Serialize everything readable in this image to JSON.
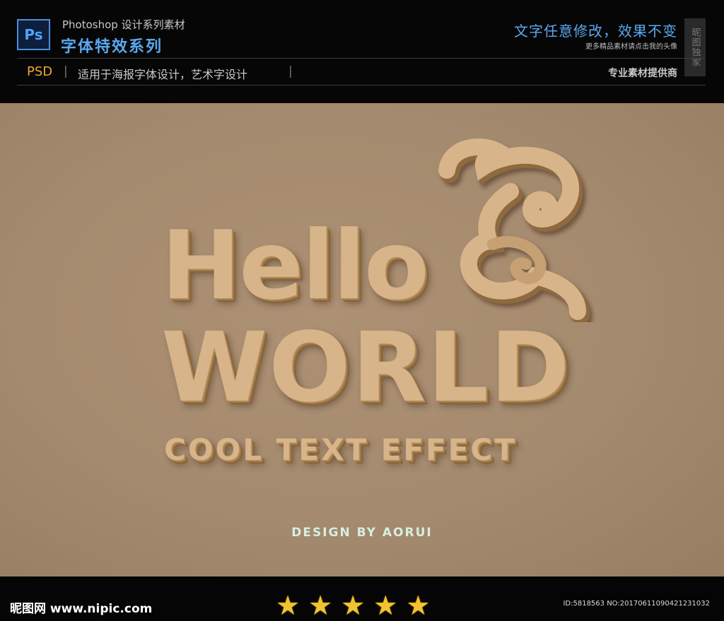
{
  "header": {
    "ps_logo": "Ps",
    "subtitle": "Photoshop 设计系列素材",
    "title": "字体特效系列",
    "right_title": "文字任意修改，效果不变",
    "right_sub": "更多精品素材请点击我的头像",
    "stamp": "昵图独家",
    "format": "PSD",
    "description": "适用于海报字体设计，艺术字设计",
    "provider": "专业素材提供商"
  },
  "poster": {
    "line1": "Hello",
    "line2": "WORLD",
    "line3": "COOL TEXT EFFECT",
    "credit": "DESIGN BY AORUI"
  },
  "footer": {
    "site": "昵图网 www.nipic.com",
    "rating": 5,
    "id_text": "ID:5818563 NO:20170611090421231032"
  },
  "colors": {
    "accent_blue": "#5aa9f0",
    "psd_orange": "#f0a830",
    "wood": "#d7b489",
    "background": "#a48a6e"
  }
}
